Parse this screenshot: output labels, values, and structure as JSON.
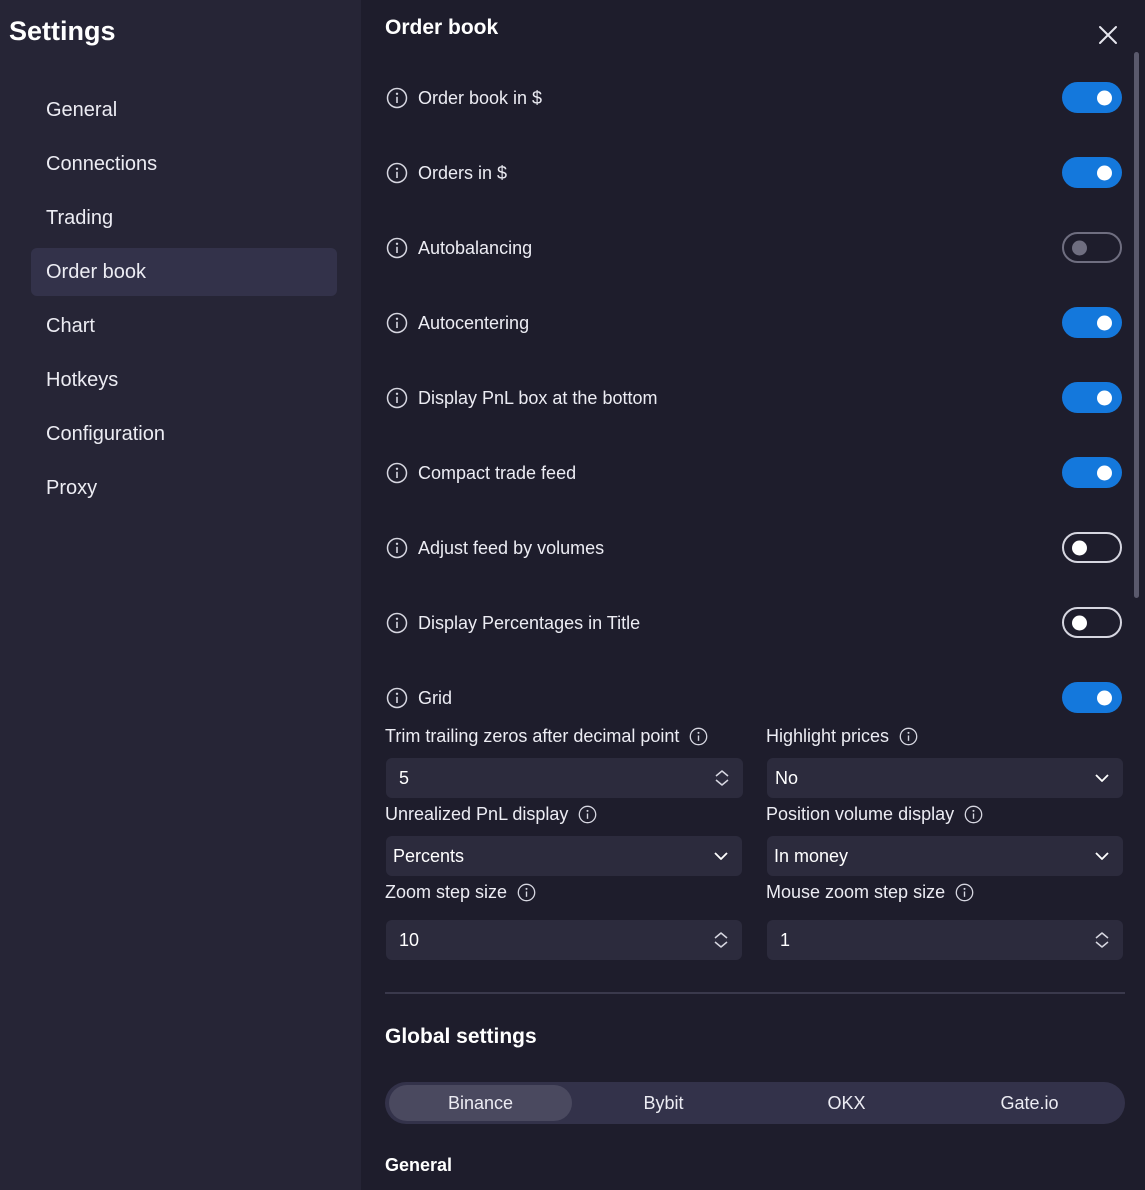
{
  "sidebar": {
    "title": "Settings",
    "items": [
      {
        "label": "General"
      },
      {
        "label": "Connections"
      },
      {
        "label": "Trading"
      },
      {
        "label": "Order book",
        "active": true
      },
      {
        "label": "Chart"
      },
      {
        "label": "Hotkeys"
      },
      {
        "label": "Configuration"
      },
      {
        "label": "Proxy"
      }
    ]
  },
  "main": {
    "title": "Order book",
    "close_icon": "close-icon",
    "toggles": [
      {
        "label": "Order book in $",
        "state": "on"
      },
      {
        "label": "Orders in $",
        "state": "on"
      },
      {
        "label": "Autobalancing",
        "state": "off-disabled"
      },
      {
        "label": "Autocentering",
        "state": "on"
      },
      {
        "label": "Display PnL box at the bottom",
        "state": "on"
      },
      {
        "label": "Compact trade feed",
        "state": "on"
      },
      {
        "label": "Adjust feed by volumes",
        "state": "off"
      },
      {
        "label": "Display Percentages in Title",
        "state": "off"
      },
      {
        "label": "Grid",
        "state": "on"
      }
    ],
    "fields": {
      "trim_zeros": {
        "label": "Trim trailing zeros after decimal point",
        "value": "5",
        "kind": "stepper"
      },
      "highlight_prices": {
        "label": "Highlight prices",
        "value": "No",
        "kind": "select"
      },
      "unrealized_pnl": {
        "label": "Unrealized PnL display",
        "value": "Percents",
        "kind": "select"
      },
      "position_volume": {
        "label": "Position volume display",
        "value": "In money",
        "kind": "select"
      },
      "zoom_step": {
        "label": "Zoom step size",
        "value": "10",
        "kind": "stepper"
      },
      "mouse_zoom_step": {
        "label": "Mouse zoom step size",
        "value": "1",
        "kind": "stepper"
      }
    }
  },
  "global": {
    "title": "Global settings",
    "exchanges": [
      "Binance",
      "Bybit",
      "OKX",
      "Gate.io"
    ],
    "active_exchange": "Binance",
    "subsection": "General"
  },
  "colors": {
    "accent": "#1478dc",
    "background": "#1e1d2c",
    "sidebar": "#262536"
  }
}
